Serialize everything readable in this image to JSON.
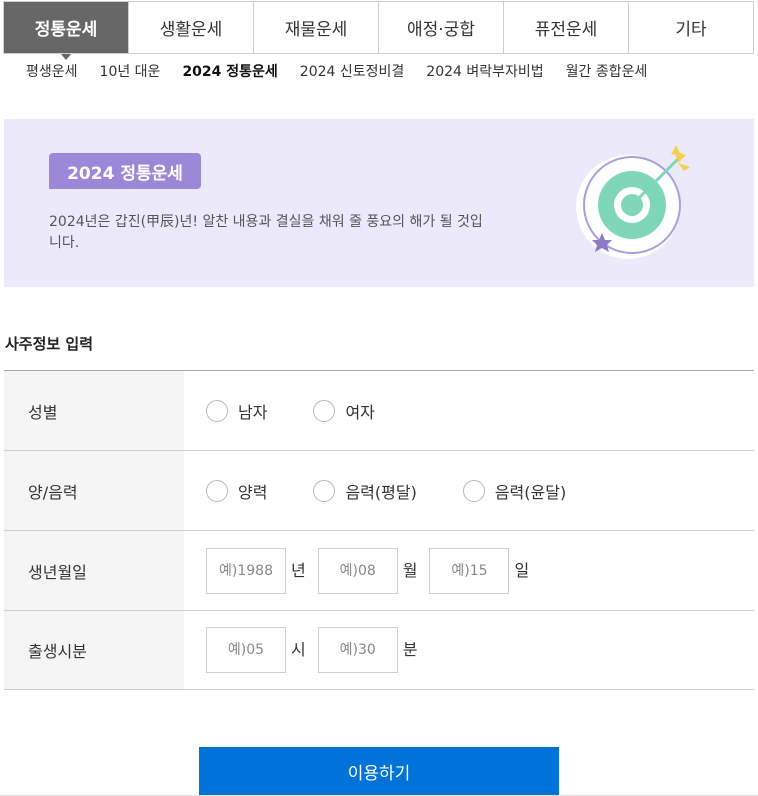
{
  "tabs": [
    {
      "label": "정통운세",
      "active": true
    },
    {
      "label": "생활운세",
      "active": false
    },
    {
      "label": "재물운세",
      "active": false
    },
    {
      "label": "애정·궁합",
      "active": false
    },
    {
      "label": "퓨전운세",
      "active": false
    },
    {
      "label": "기타",
      "active": false
    }
  ],
  "subnav": [
    {
      "label": "평생운세",
      "active": false
    },
    {
      "label": "10년 대운",
      "active": false
    },
    {
      "label": "2024 정통운세",
      "active": true
    },
    {
      "label": "2024 신토정비결",
      "active": false
    },
    {
      "label": "2024 벼락부자비법",
      "active": false
    },
    {
      "label": "월간 종합운세",
      "active": false
    }
  ],
  "banner": {
    "title": "2024 정통운세",
    "description": "2024년은 갑진(甲辰)년! 알찬 내용과 결실을 채워 줄 풍요의 해가 될 것입니다.",
    "colors": {
      "background": "#ece9fb",
      "title_bg": "#9b88d9",
      "target": "#7fd6b8",
      "arrow": "#f2d14b",
      "star": "#8a7cc7"
    }
  },
  "form": {
    "section_title": "사주정보 입력",
    "gender": {
      "label": "성별",
      "options": [
        "남자",
        "여자"
      ]
    },
    "calendar": {
      "label": "양/음력",
      "options": [
        "양력",
        "음력(평달)",
        "음력(윤달)"
      ]
    },
    "birthdate": {
      "label": "생년월일",
      "year": {
        "placeholder": "예)1988",
        "value": "",
        "unit": "년"
      },
      "month": {
        "placeholder": "예)08",
        "value": "",
        "unit": "월"
      },
      "day": {
        "placeholder": "예)15",
        "value": "",
        "unit": "일"
      }
    },
    "birthtime": {
      "label": "출생시분",
      "hour": {
        "placeholder": "예)05",
        "value": "",
        "unit": "시"
      },
      "minute": {
        "placeholder": "예)30",
        "value": "",
        "unit": "분"
      }
    }
  },
  "submit": {
    "label": "이용하기",
    "color": "#0073d9"
  }
}
